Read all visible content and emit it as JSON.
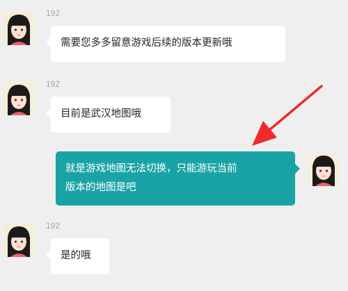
{
  "colors": {
    "background": "#efefef",
    "incoming_bubble": "#ffffff",
    "outgoing_bubble": "#1aa3a6",
    "annotation_arrow": "#ee2a2a"
  },
  "messages": [
    {
      "direction": "incoming",
      "sender": "192",
      "text": "需要您多多留意游戏后续的版本更新哦",
      "avatar_icon": "girl-avatar-icon"
    },
    {
      "direction": "incoming",
      "sender": "192",
      "text": "目前是武汉地图哦",
      "avatar_icon": "girl-avatar-icon"
    },
    {
      "direction": "outgoing",
      "text_line1": "就是游戏地图无法切换，只能游玩当前",
      "text_line2": "版本的地图是吧",
      "avatar_icon": "girl-avatar-icon"
    },
    {
      "direction": "incoming",
      "sender": "192",
      "text": "是的哦",
      "avatar_icon": "girl-avatar-icon"
    }
  ],
  "annotation": {
    "icon": "red-arrow-icon"
  }
}
